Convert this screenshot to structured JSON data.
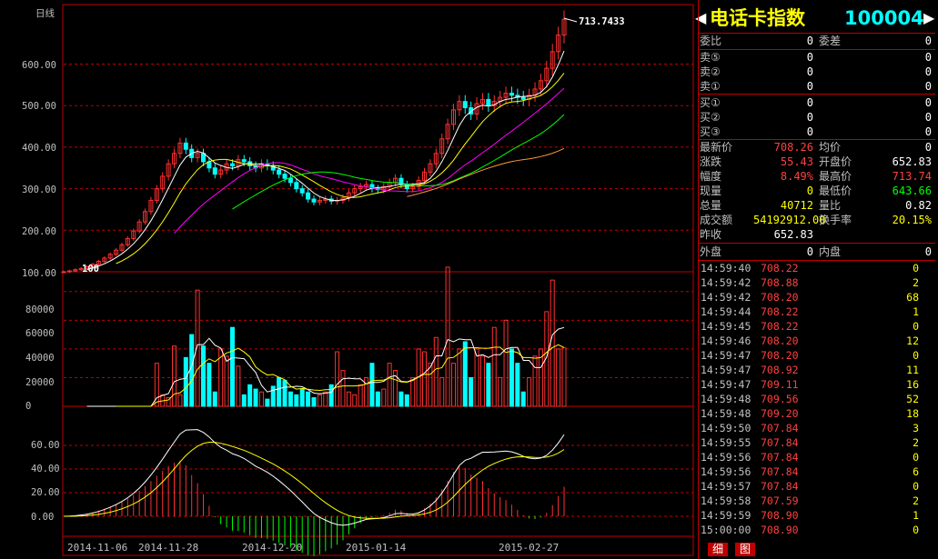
{
  "chart_title": "日线",
  "price_ticks": [
    "600.00",
    "500.00",
    "400.00",
    "300.00",
    "200.00",
    "100.00"
  ],
  "volume_ticks": [
    "80000",
    "60000",
    "40000",
    "20000",
    "0"
  ],
  "macd_ticks": [
    "60.00",
    "40.00",
    "20.00",
    "0.00"
  ],
  "x_ticks": [
    "2014-11-06",
    "2014-11-28",
    "2014-12-20",
    "2015-01-14",
    "2015-02-27"
  ],
  "high_label": "713.7433",
  "low_label": "100",
  "header": {
    "name": "电话卡指数",
    "code": "100004",
    "left_arrow": "◀",
    "right_arrow": "▶"
  },
  "order": {
    "webi_label": "委比",
    "webi": "0",
    "weicha_label": "委差",
    "weicha": "0",
    "sells": [
      {
        "label": "卖⑤",
        "p": "0",
        "v": "0"
      },
      {
        "label": "卖②",
        "p": "0",
        "v": "0"
      },
      {
        "label": "卖①",
        "p": "0",
        "v": "0"
      }
    ],
    "buys": [
      {
        "label": "买①",
        "p": "0",
        "v": "0"
      },
      {
        "label": "买②",
        "p": "0",
        "v": "0"
      },
      {
        "label": "买③",
        "p": "0",
        "v": "0"
      }
    ]
  },
  "quote": {
    "last_label": "最新价",
    "last": "708.26",
    "avg_label": "均价",
    "avg": "0",
    "chg_label": "涨跌",
    "chg": "55.43",
    "open_label": "开盘价",
    "open": "652.83",
    "pct_label": "幅度",
    "pct": "8.49%",
    "high_label": "最高价",
    "high": "713.74",
    "cur_label": "现量",
    "cur": "0",
    "low_label": "最低价",
    "low": "643.66",
    "tot_label": "总量",
    "tot": "40712",
    "vr_label": "量比",
    "vr": "0.82",
    "amt_label": "成交额",
    "amt": "54192912.00",
    "turn_label": "换手率",
    "turn": "20.15%",
    "prev_label": "昨收",
    "prev": "652.83",
    "outer_label": "外盘",
    "outer": "0",
    "inner_label": "内盘",
    "inner": "0"
  },
  "ticks": [
    [
      "14:59:40",
      "708.22",
      "0"
    ],
    [
      "14:59:42",
      "708.88",
      "2"
    ],
    [
      "14:59:42",
      "708.20",
      "68"
    ],
    [
      "14:59:44",
      "708.22",
      "1"
    ],
    [
      "14:59:45",
      "708.22",
      "0"
    ],
    [
      "14:59:46",
      "708.20",
      "12"
    ],
    [
      "14:59:47",
      "708.20",
      "0"
    ],
    [
      "14:59:47",
      "708.92",
      "11"
    ],
    [
      "14:59:47",
      "709.11",
      "16"
    ],
    [
      "14:59:48",
      "709.56",
      "52"
    ],
    [
      "14:59:48",
      "709.20",
      "18"
    ],
    [
      "14:59:50",
      "707.84",
      "3"
    ],
    [
      "14:59:55",
      "707.84",
      "2"
    ],
    [
      "14:59:56",
      "707.84",
      "0"
    ],
    [
      "14:59:56",
      "707.84",
      "6"
    ],
    [
      "14:59:57",
      "707.84",
      "0"
    ],
    [
      "14:59:58",
      "707.59",
      "2"
    ],
    [
      "14:59:59",
      "708.90",
      "1"
    ],
    [
      "15:00:00",
      "708.90",
      "0"
    ]
  ],
  "tabs": [
    "细",
    "图"
  ],
  "chart_data": {
    "type": "candlestick",
    "price_range": [
      100,
      715
    ],
    "volume_range": [
      0,
      90000
    ],
    "macd_range": [
      -30,
      80
    ],
    "closes": [
      100,
      102,
      105,
      108,
      112,
      118,
      125,
      133,
      142,
      152,
      165,
      180,
      198,
      220,
      245,
      272,
      300,
      330,
      360,
      385,
      410,
      395,
      375,
      385,
      365,
      350,
      335,
      345,
      360,
      355,
      370,
      365,
      355,
      350,
      360,
      355,
      345,
      335,
      325,
      315,
      300,
      290,
      275,
      268,
      272,
      275,
      270,
      272,
      278,
      290,
      300,
      305,
      310,
      300,
      298,
      305,
      315,
      325,
      310,
      300,
      305,
      320,
      340,
      360,
      385,
      420,
      455,
      490,
      510,
      495,
      480,
      505,
      515,
      500,
      510,
      520,
      530,
      525,
      520,
      515,
      525,
      540,
      560,
      590,
      630,
      670,
      708
    ],
    "volumes": [
      0,
      0,
      0,
      0,
      0,
      0,
      0,
      0,
      0,
      0,
      0,
      0,
      0,
      0,
      0,
      0,
      30000,
      8000,
      6000,
      42000,
      8000,
      34000,
      50000,
      81000,
      42000,
      30000,
      10000,
      40000,
      35000,
      55000,
      28000,
      8000,
      15000,
      12000,
      10000,
      5000,
      14000,
      20000,
      18000,
      10000,
      8000,
      12000,
      10000,
      6000,
      8000,
      10000,
      15000,
      38000,
      25000,
      10000,
      8000,
      15000,
      20000,
      30000,
      10000,
      12000,
      30000,
      25000,
      10000,
      8000,
      20000,
      40000,
      38000,
      30000,
      48000,
      20000,
      97000,
      30000,
      40000,
      45000,
      20000,
      40000,
      35000,
      30000,
      55000,
      20000,
      60000,
      40000,
      30000,
      10000,
      20000,
      35000,
      40000,
      66000,
      88000,
      40000,
      40712
    ]
  }
}
